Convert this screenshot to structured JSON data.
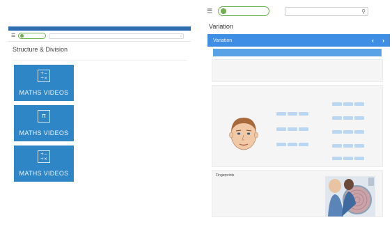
{
  "left": {
    "top_bar": {
      "left": "",
      "right": ""
    },
    "logo_text": "",
    "search_placeholder": "",
    "sign_in": "",
    "title": "Structure & Division",
    "meta": "",
    "tabs": [
      "",
      "",
      ""
    ],
    "sort_label": "",
    "sort_value": "",
    "sort_right": "",
    "videos": [
      {
        "thumb_glyph": "+−\n÷×",
        "brand": "MATHS VIDEOS",
        "title": "",
        "subtitle": "",
        "description": "",
        "tag": "",
        "links": ""
      },
      {
        "thumb_glyph": "π",
        "brand": "MATHS VIDEOS",
        "title": "",
        "subtitle": "",
        "description": "",
        "tag": "",
        "links": ""
      },
      {
        "thumb_glyph": "+−\n÷×",
        "brand": "MATHS VIDEOS",
        "title": "",
        "subtitle": "",
        "description": "",
        "tag": "",
        "links": ""
      }
    ]
  },
  "right": {
    "logo_text": "",
    "search_placeholder": "",
    "title": "Variation",
    "breadcrumb": "",
    "bar_title": "Variation",
    "page_indicator": "",
    "section_heading": "",
    "definition": {
      "title": "",
      "text": ""
    },
    "examples": {
      "title": "",
      "text": "",
      "groups": [
        {
          "label": ""
        },
        {
          "label": ""
        },
        {
          "label": ""
        },
        {
          "label": ""
        },
        {
          "label": ""
        },
        {
          "label": ""
        },
        {
          "label": ""
        },
        {
          "label": ""
        }
      ]
    },
    "fingerprints": {
      "title": "Fingerprints",
      "text": ""
    }
  },
  "colors": {
    "accent_blue": "#3d8ee4",
    "brand_green": "#6bb04a",
    "thumb_blue": "#2f86c7"
  },
  "icons": [
    "hamburger-icon",
    "search-icon",
    "chevron-left-icon",
    "chevron-right-icon",
    "maths-operators-icon",
    "pi-icon"
  ]
}
